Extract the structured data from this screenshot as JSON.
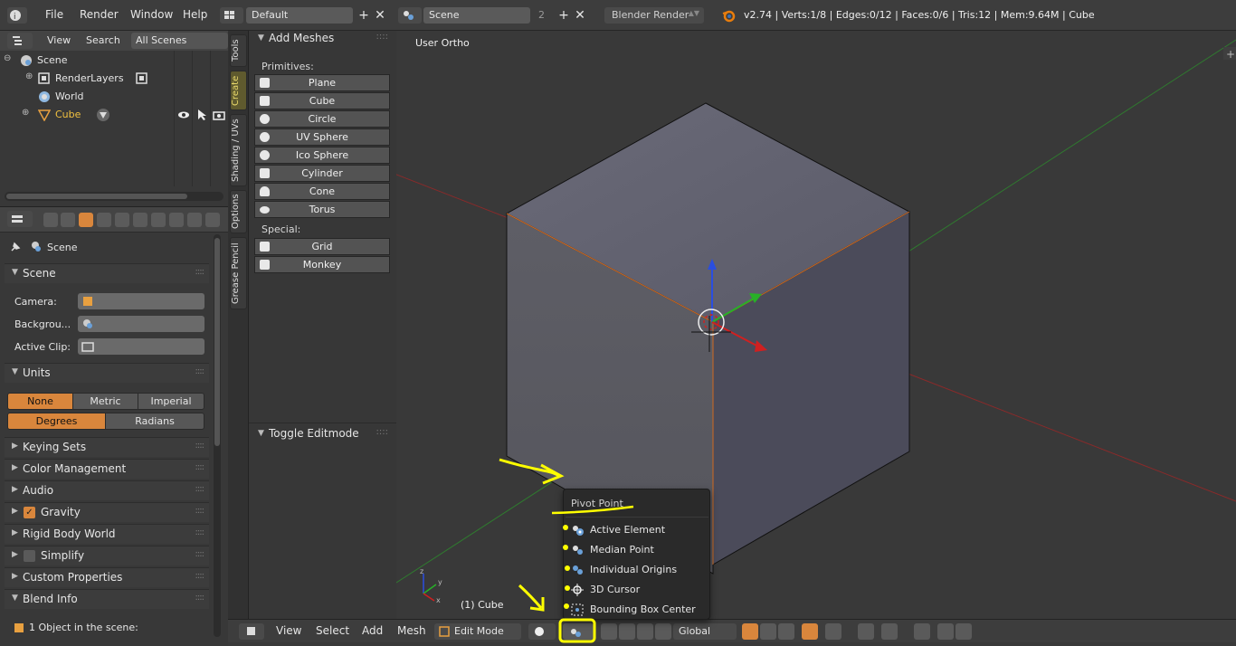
{
  "topbar": {
    "menus": [
      "File",
      "Render",
      "Window",
      "Help"
    ],
    "layout_value": "Default",
    "scene_value": "Scene",
    "scene_users": "2",
    "engine": "Blender Render",
    "stats": "v2.74 | Verts:1/8 | Edges:0/12 | Faces:0/6 | Tris:12 | Mem:9.64M | Cube"
  },
  "outliner": {
    "menus": [
      "View",
      "Search"
    ],
    "filter": "All Scenes",
    "items": [
      "Scene",
      "RenderLayers",
      "World",
      "Cube"
    ]
  },
  "properties": {
    "context": "Scene",
    "panels": {
      "scene": "Scene",
      "camera_label": "Camera:",
      "background_label": "Backgrou...",
      "clip_label": "Active Clip:",
      "units": "Units",
      "unit_none": "None",
      "unit_metric": "Metric",
      "unit_imperial": "Imperial",
      "unit_degrees": "Degrees",
      "unit_radians": "Radians",
      "keying": "Keying Sets",
      "color": "Color Management",
      "audio": "Audio",
      "gravity": "Gravity",
      "rigid": "Rigid Body World",
      "simplify": "Simplify",
      "custom": "Custom Properties",
      "blend": "Blend Info",
      "blend_info": "1 Object in the scene:"
    }
  },
  "vtabs": [
    "Tools",
    "Create",
    "Shading / UVs",
    "Options",
    "Grease Pencil"
  ],
  "toolshelf": {
    "add_meshes": "Add Meshes",
    "primitives": "Primitives:",
    "buttons": [
      "Plane",
      "Cube",
      "Circle",
      "UV Sphere",
      "Ico Sphere",
      "Cylinder",
      "Cone",
      "Torus"
    ],
    "special": "Special:",
    "special_buttons": [
      "Grid",
      "Monkey"
    ],
    "toggle": "Toggle Editmode"
  },
  "viewport": {
    "label": "User Ortho",
    "object": "(1) Cube"
  },
  "bottombar": {
    "menus": [
      "View",
      "Select",
      "Add",
      "Mesh"
    ],
    "mode": "Edit Mode",
    "orientation": "Global"
  },
  "pivot_menu": {
    "title": "Pivot Point",
    "items": [
      "Active Element",
      "Median Point",
      "Individual Origins",
      "3D Cursor",
      "Bounding Box Center"
    ]
  },
  "colors": {
    "accent": "#d9863c",
    "annotation": "#ffff00",
    "selected_text": "#f0c040"
  }
}
